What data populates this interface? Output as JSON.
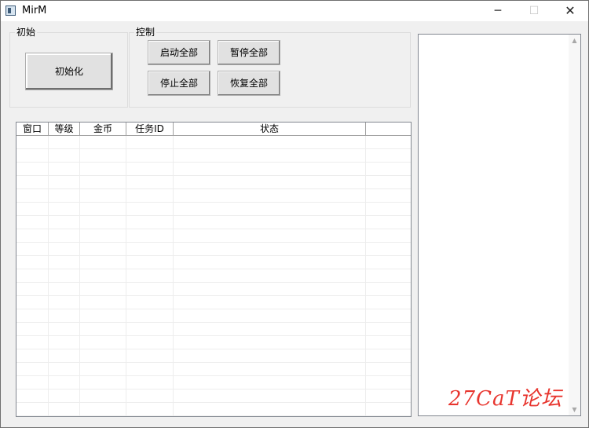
{
  "window": {
    "title": "MirM",
    "minimize_glyph": "─",
    "maximize_glyph": "☐",
    "close_glyph": "✕"
  },
  "groups": {
    "init": {
      "label": "初始",
      "init_button": "初始化"
    },
    "control": {
      "label": "控制",
      "buttons": [
        "启动全部",
        "暂停全部",
        "停止全部",
        "恢复全部"
      ]
    }
  },
  "table": {
    "columns": [
      "窗口",
      "等级",
      "金币",
      "任务ID",
      "状态",
      ""
    ],
    "rows": []
  },
  "log": {
    "text": ""
  },
  "scroll": {
    "up_glyph": "▲",
    "down_glyph": "▼"
  },
  "watermark": "27CaT论坛"
}
